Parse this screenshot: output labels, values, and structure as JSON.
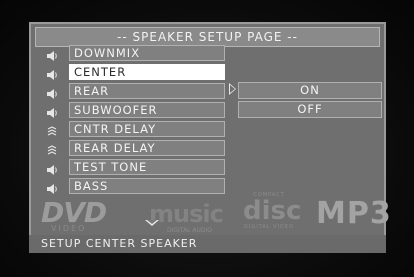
{
  "title": "-- SPEAKER SETUP PAGE --",
  "menu": {
    "items": [
      {
        "label": "DOWNMIX",
        "icon": "speaker-icon"
      },
      {
        "label": "CENTER",
        "icon": "speaker-icon"
      },
      {
        "label": "REAR",
        "icon": "speaker-icon"
      },
      {
        "label": "SUBWOOFER",
        "icon": "speaker-icon"
      },
      {
        "label": "CNTR DELAY",
        "icon": "speaker-delay-icon"
      },
      {
        "label": "REAR DELAY",
        "icon": "speaker-delay-icon"
      },
      {
        "label": "TEST TONE",
        "icon": "speaker-icon"
      },
      {
        "label": "BASS",
        "icon": "speaker-icon"
      }
    ],
    "selected_label": "CENTER"
  },
  "options": {
    "items": [
      {
        "label": "ON"
      },
      {
        "label": "OFF"
      }
    ]
  },
  "status": "SETUP CENTER SPEAKER",
  "background_logos": {
    "dvd": "DVD",
    "video": "VIDEO",
    "music": "music",
    "digital_audio": "DIGITAL AUDIO",
    "disc": "disc",
    "compact": "COMPACT",
    "digital_video": "DIGITAL VIDEO",
    "mp3": "MP3"
  },
  "colors": {
    "panel": "#6f6f6f",
    "item": "#808080",
    "selected": "#ffffff",
    "text": "#f4f4f4"
  }
}
